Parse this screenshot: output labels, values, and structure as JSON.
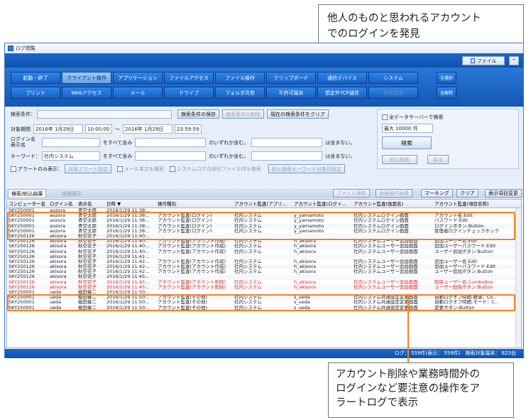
{
  "window": {
    "title": "ログ閲覧"
  },
  "toolbar": {
    "file_label": "ファイル",
    "collapse_label": "^"
  },
  "categories_row1": [
    "起動・終了",
    "クライアント操作",
    "アプリケーション",
    "ファイルアクセス",
    "ファイル操作",
    "クリップボード",
    "通信デバイス",
    "システム"
  ],
  "categories_row2": [
    "プリント",
    "Webアクセス",
    "メール",
    "ドライブ",
    "フォルダ共有",
    "不許可端末",
    "想定外TCP通信",
    "検索監視"
  ],
  "side_buttons": {
    "select_all": "全選択",
    "deselect_all": "全解除"
  },
  "search": {
    "condition_label": "検索条件：",
    "save_btn": "検索条件の保存",
    "delete_btn": "検索条件の削除",
    "clear_btn": "現在の検索条件をクリア",
    "period_label": "対象期間",
    "date_from": "2016年 1月29日",
    "time_from": "10:00:00",
    "tilde": "〜",
    "date_to": "2016年 1月29日",
    "time_to": "23:59:59",
    "login_label": "ログイン名",
    "display_label": "表示名",
    "contains_all": "をすべて含み",
    "contains_any": "のいずれか含む。",
    "not_contains": "は含まない。",
    "keyword_label": "キーワード：",
    "keyword_value": "社内システム",
    "alert_only": "アラートのみ表示：",
    "alert_setting": "対象アラート設定",
    "mail_body": "メール本文も検索",
    "attach_search": "システムログの添付ファイル内も検索",
    "refine_keyword": "絞込検索キーワード対象列設定",
    "all_servers": "全データサーバーで検索",
    "max_count": "最大 10000 件",
    "search_btn": "検索",
    "refine_btn": "絞込検索",
    "back_btn": "戻る"
  },
  "result_bar": {
    "tab_search": "検索/絞込結果",
    "tab_detail": "詳細表示",
    "file_save": "ファイル保存",
    "screen_image": "画面操作画像",
    "marking": "マーキング",
    "clear": "クリア",
    "col_change": "表示項目変更"
  },
  "grid": {
    "headers": [
      "コンピューター名",
      "ログイン名",
      "表示名",
      "日時 ▼",
      "操作種別",
      "アカウント監査(アプリ...",
      "アカウント監査(ログイ...",
      "アカウント監査(画面名)",
      "アカウント監査(項目名称)"
    ],
    "rows": [
      {
        "c": [
          "SKY250001",
          "aozora",
          "青空太郎",
          "2016/1/29 11:38:..",
          "",
          "",
          "",
          "",
          ""
        ],
        "alert": false
      },
      {
        "c": [
          "SKY250001",
          "aozora",
          "青空太郎",
          "2016/1/29 11:38:..",
          "アカウント監査(ログイン)",
          "社内システム",
          "y_yamamoto",
          "社内システムログイン画面",
          "アカウント名:Edit"
        ],
        "alert": false
      },
      {
        "c": [
          "SKY250001",
          "aozora",
          "青空太郎",
          "2016/1/29 11:38:..",
          "アカウント監査(ログイン)",
          "社内システム",
          "y_yamamoto",
          "社内システムログイン画面",
          "パスワード:Edit"
        ],
        "alert": false
      },
      {
        "c": [
          "SKY250001",
          "aozora",
          "青空太郎",
          "2016/1/29 11:38:..",
          "アカウント監査(ログイン)",
          "社内システム",
          "y_yamamoto",
          "社内システムログイン画面",
          "ログインボタン:Button"
        ],
        "alert": false
      },
      {
        "c": [
          "SKY250001",
          "aozora",
          "青空太郎",
          "2016/1/29 11:38:..",
          "アカウント監査(ログイン)",
          "社内システム",
          "y_yamamoto",
          "社内システムログイン画面",
          "管理者ログインチェックボック"
        ],
        "alert": false
      },
      {
        "c": [
          "SKY250126",
          "akisora",
          "秋空花子",
          "2016/1/29 11:40:..",
          "",
          "",
          "",
          "",
          ""
        ],
        "alert": false
      },
      {
        "c": [
          "SKY250126",
          "akisora",
          "秋空花子",
          "2016/1/29 11:40:..",
          "アカウント監査(アカウント作成)",
          "社内システム",
          "h_akisora",
          "社内システムユーザー追加画面",
          "追加ユーザー名:Edit"
        ],
        "alert": false
      },
      {
        "c": [
          "SKY250126",
          "akisora",
          "秋空花子",
          "2016/1/29 11:40:..",
          "アカウント監査(アカウント作成)",
          "社内システム",
          "h_akisora",
          "社内システムユーザー追加画面",
          "追加ユーザーパスワード:Edit"
        ],
        "alert": false
      },
      {
        "c": [
          "SKY250126",
          "akisora",
          "秋空花子",
          "2016/1/29 11:40:..",
          "アカウント監査(アカウント作成)",
          "社内システム",
          "h_akisora",
          "社内システムユーザー追加画面",
          "ユーザー追加ボタン:Button"
        ],
        "alert": false
      },
      {
        "c": [
          "SKY250126",
          "akisora",
          "秋空花子",
          "2016/1/29 11:41:..",
          "",
          "",
          "",
          "",
          ""
        ],
        "alert": false
      },
      {
        "c": [
          "SKY250126",
          "akisora",
          "秋空花子",
          "2016/1/29 11:42:..",
          "アカウント監査(アカウント作成)",
          "社内システム",
          "h_akisora",
          "社内システムユーザー追加画面",
          "追加ユーザー名:Edit"
        ],
        "alert": false
      },
      {
        "c": [
          "SKY250126",
          "akisora",
          "秋空花子",
          "2016/1/29 11:42:..",
          "アカウント監査(アカウント作成)",
          "社内システム",
          "h_akisora",
          "社内システムユーザー追加画面",
          "追加ユーザーパスワード:Edit"
        ],
        "alert": false
      },
      {
        "c": [
          "SKY250126",
          "akisora",
          "秋空花子",
          "2016/1/29 11:42:..",
          "アカウント監査(アカウント作成)",
          "社内システム",
          "h_akisora",
          "社内システムユーザー追加画面",
          "ユーザー追加ボタン:Button"
        ],
        "alert": false
      },
      {
        "c": [
          "SKY250126",
          "akisora",
          "秋空花子",
          "2016/1/29 11:45:..",
          "",
          "",
          "",
          "",
          ""
        ],
        "alert": false
      },
      {
        "c": [
          "SKY250126",
          "akisora",
          "秋空花子",
          "2016/1/29 11:45:..",
          "アカウント監査(アカウント削除)",
          "社内システム",
          "h_akisora",
          "社内システムユーザー追加画面",
          "削除ユーザー名:ComboBox"
        ],
        "alert": true
      },
      {
        "c": [
          "SKY250126",
          "akisora",
          "秋空花子",
          "2016/1/29 11:45:..",
          "アカウント監査(アカウント削除)",
          "社内システム",
          "h_akisora",
          "社内システムユーザー追加画面",
          "ユーザー削除ボタン:Button"
        ],
        "alert": true
      },
      {
        "c": [
          "SKY250001",
          "ueda",
          "植田春二",
          "2016/1/29 11:50:..",
          "",
          "",
          "",
          "",
          ""
        ],
        "alert": false
      },
      {
        "c": [
          "SKY250001",
          "ueda",
          "植田春二",
          "2016/1/29 11:50:..",
          "アカウント監査(その他)",
          "社内システム",
          "s_ueda",
          "社内システム共通設定変更画面",
          "自動ログオフ時間-数値：Co.."
        ],
        "alert": false
      },
      {
        "c": [
          "SKY250001",
          "ueda",
          "植田春二",
          "2016/1/29 11:50:..",
          "アカウント監査(その他)",
          "社内システム",
          "s_ueda",
          "社内システム共通設定変更画面",
          "自動ログオフ時間-モード：C.."
        ],
        "alert": false
      },
      {
        "c": [
          "SKY250001",
          "ueda",
          "植田春二",
          "2016/1/29 11:50:..",
          "アカウント監査(その他)",
          "社内システム",
          "s_ueda",
          "社内システム共通設定変更画面",
          "変更ボタン:Button"
        ],
        "alert": false
      }
    ]
  },
  "status": {
    "text": "ログ： 559件(表示： 559件)　検索対象端末： 823台"
  },
  "callouts": {
    "top": "他人のものと思われるアカウント\nでのログインを発見",
    "bottom": "アカウント削除や業務時間外の\nログインなど要注意の操作をア\nラートログで表示"
  },
  "colors": {
    "accent": "#f58220",
    "alert_text": "#e02020",
    "band_blue": "#1456b5"
  }
}
